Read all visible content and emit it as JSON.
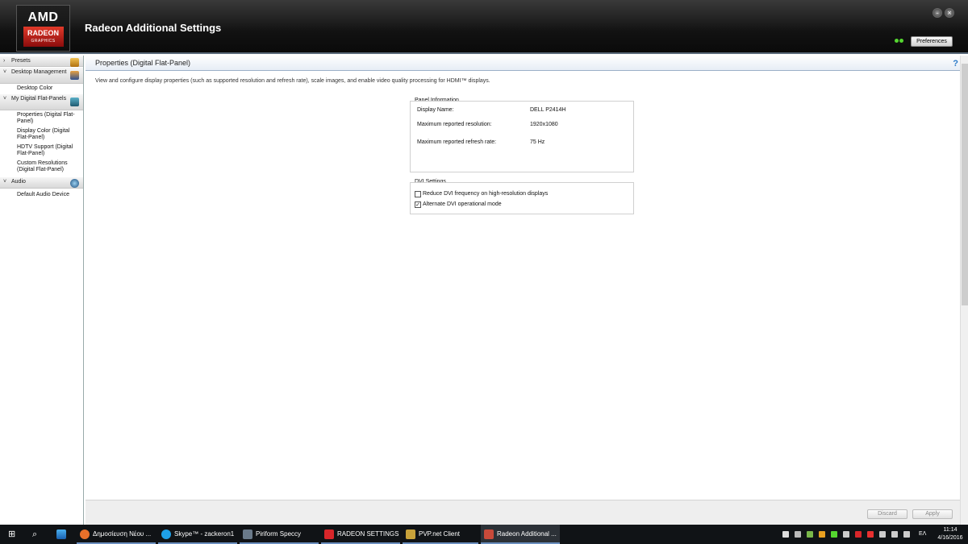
{
  "header": {
    "logo_top": "AMD",
    "logo_main": "RADEON",
    "logo_sub": "GRAPHICS",
    "app_title": "Radeon Additional Settings",
    "preferences_label": "Preferences"
  },
  "sidebar": {
    "categories": [
      {
        "label": "Presets",
        "expanded": false
      },
      {
        "label": "Desktop Management",
        "expanded": true,
        "children": [
          "Desktop Color"
        ]
      },
      {
        "label": "My Digital Flat-Panels",
        "expanded": true,
        "children": [
          "Properties (Digital Flat-Panel)",
          "Display Color (Digital Flat-Panel)",
          "HDTV Support (Digital Flat-Panel)",
          "Custom Resolutions (Digital Flat-Panel)"
        ]
      },
      {
        "label": "Audio",
        "expanded": true,
        "children": [
          "Default Audio Device"
        ]
      }
    ]
  },
  "main": {
    "page_title": "Properties (Digital Flat-Panel)",
    "help_label": "?",
    "description": "View and configure display properties (such as supported resolution and refresh rate), scale images, and enable video quality processing for HDMI™ displays.",
    "panel_info": {
      "title": "Panel Information",
      "rows": [
        {
          "label": "Display Name:",
          "value": "DELL P2414H"
        },
        {
          "label": "Maximum reported resolution:",
          "value": "1920x1080"
        },
        {
          "label": "Maximum reported refresh rate:",
          "value": "75 Hz"
        }
      ]
    },
    "dvi": {
      "title": "DVI Settings",
      "options": [
        {
          "label": "Reduce DVI frequency on high-resolution displays",
          "checked": false
        },
        {
          "label": "Alternate DVI operational mode",
          "checked": true
        }
      ]
    },
    "discard_label": "Discard",
    "apply_label": "Apply"
  },
  "taskbar": {
    "items": [
      {
        "label": "Δημοσίευση Νέου ...",
        "color": "#e8702a"
      },
      {
        "label": "Skype™ - zackeron1",
        "color": "#1ea0e8"
      },
      {
        "label": "Piriform Speccy",
        "color": "#6a7a8a"
      },
      {
        "label": "RADEON SETTINGS",
        "color": "#d8262a"
      },
      {
        "label": "PVP.net Client",
        "color": "#c8a23a"
      },
      {
        "label": "Radeon Additional ...",
        "color": "#c84a3a"
      }
    ],
    "language": "ΕΛ",
    "time": "11:14",
    "date": "4/16/2016"
  },
  "colors": {
    "accent_blue": "#2a7ac9",
    "amd_red": "#d8262a",
    "status_green": "#55d630"
  }
}
